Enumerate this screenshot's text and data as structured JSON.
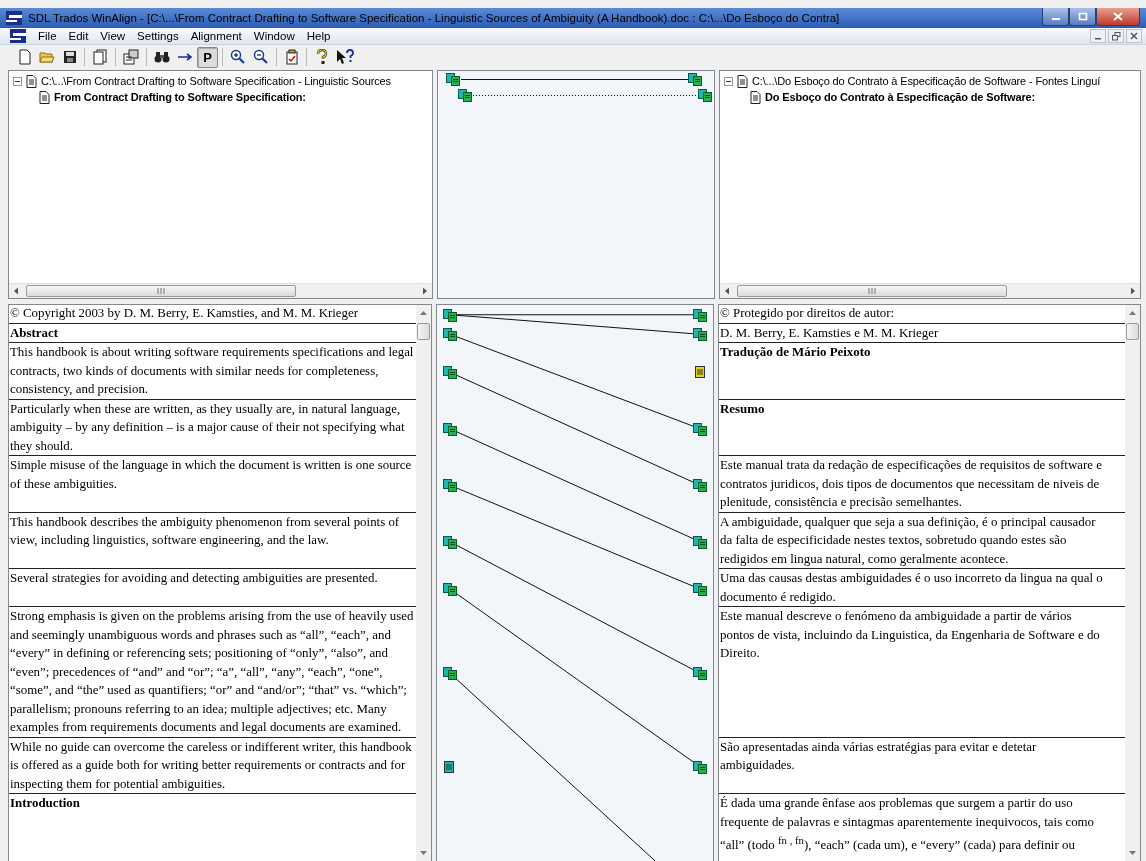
{
  "window": {
    "title": "SDL Trados WinAlign - [C:\\...\\From Contract Drafting to Software Specification - Linguistic Sources of Ambiguity (A Handbook).doc : C:\\...\\Do Esboço do Contra]"
  },
  "menu": [
    "File",
    "Edit",
    "View",
    "Settings",
    "Alignment",
    "Window",
    "Help"
  ],
  "toolbar": {
    "text_button": {
      "label": "P",
      "pressed": true
    }
  },
  "source_tree": {
    "path": "C:\\...\\From Contract Drafting to Software Specification - Linguistic Sources",
    "expanded": true,
    "children": [
      {
        "label": "From Contract Drafting to Software Specification:"
      }
    ]
  },
  "target_tree": {
    "path": "C:\\...\\Do Esboço do Contrato à Especificação de Software - Fontes Linguí",
    "expanded": true,
    "children": [
      {
        "label": "Do Esboço do Contrato à Especificação de Software:"
      }
    ]
  },
  "top_links": [
    {
      "dotted": false
    },
    {
      "dotted": true
    }
  ],
  "segments": [
    {
      "source": {
        "text": "© Copyright 2003 by D. M. Berry, E. Kamsties, and M. M. Krieger",
        "bold": false,
        "aligned": true
      },
      "target": {
        "text": "© Protegido por direitos de autor:",
        "bold": false,
        "aligned": true,
        "joined": false
      }
    },
    {
      "source": {
        "text": "Abstract",
        "bold": true,
        "aligned": true
      },
      "target": {
        "text": "D. M. Berry, E. Kamsties e M. M. Krieger",
        "bold": false,
        "aligned": true,
        "joined": true
      }
    },
    {
      "source": {
        "text": "This handbook is about writing software requirements specifications and legal contracts, two kinds of documents with similar needs for completeness, consistency, and precision.",
        "bold": false,
        "aligned": true
      },
      "target": {
        "text": "Tradução de Mário Peixoto",
        "bold": true,
        "aligned": false
      }
    },
    {
      "source": {
        "text": "Particularly when these are written, as they usually are, in natural language, ambiguity – by any definition – is a major cause of their not specifying what they should.",
        "bold": false,
        "aligned": true
      },
      "target": {
        "text": "Resumo",
        "bold": true,
        "aligned": true,
        "joined": false
      }
    },
    {
      "source": {
        "text": "Simple misuse of the language in which the document is written is one source of these ambiguities.",
        "bold": false,
        "aligned": true
      },
      "target": {
        "text": "Este manual trata da redação de especificações de requisitos de software e contratos juridicos, dois tipos de documentos que necessitam de niveis de plenitude, consistência e precisão semelhantes.",
        "bold": false,
        "aligned": true,
        "joined": false
      }
    },
    {
      "source": {
        "text": "This handbook describes the ambiguity phenomenon from several points of view, including linguistics, software engineering, and the law.",
        "bold": false,
        "aligned": true
      },
      "target": {
        "text": "A ambiguidade, qualquer que seja a sua definição, é o principal causador da falta de especificidade nestes textos, sobretudo quando estes são redigidos em lingua natural, como geralmente acontece.",
        "bold": false,
        "aligned": true,
        "joined": false
      }
    },
    {
      "source": {
        "text": "Several strategies for avoiding and detecting ambiguities are presented.",
        "bold": false,
        "aligned": true
      },
      "target": {
        "text": "Uma das causas destas ambiguidades é o uso incorreto da lingua na qual o documento é redigido.",
        "bold": false,
        "aligned": true,
        "joined": false
      }
    },
    {
      "source": {
        "text": "Strong emphasis is given on the problems arising from the use of heavily used and seemingly unambiguous words and phrases such as “all”, “each”, and “every” in defining or referencing sets; positioning of “only”, “also”, and “even”; precedences of “and” and “or”; “a”, “all”, “any”, “each”, “one”, “some”, and “the” used as quantifiers; “or” and “and/or”; “that” vs. “which”; parallelism; pronouns referring to an idea; multiple adjectives; etc. Many examples from requirements documents and legal documents are examined.",
        "bold": false,
        "aligned": true
      },
      "target": {
        "text": "Este manual descreve o fenómeno da ambiguidade a partir de vários pontos de vista, incluindo da Linguistica, da Engenharia de Software e do Direito.",
        "bold": false,
        "aligned": true,
        "joined": false
      }
    },
    {
      "source": {
        "text": "While no guide can overcome the careless or indifferent writer, this handbook is offered as a guide both for writing better requirements or contracts and for inspecting them for potential ambiguities.",
        "bold": false,
        "aligned": false
      },
      "target": {
        "text": "São apresentadas ainda várias estratégias para evitar e detetar ambiguidades.",
        "bold": false,
        "aligned": true,
        "joined": false
      }
    },
    {
      "source": {
        "text": "Introduction",
        "bold": true
      },
      "target": {
        "text": "É dada uma grande ênfase aos problemas que surgem a partir do uso frequente de palavras e sintagmas aparentemente inequivocos, tais como “all” (todo $^{fn , fn}$), “each” (cada um), e “every” (cada) para definir ou",
        "bold": false,
        "aligned": true,
        "joined": false
      }
    }
  ]
}
